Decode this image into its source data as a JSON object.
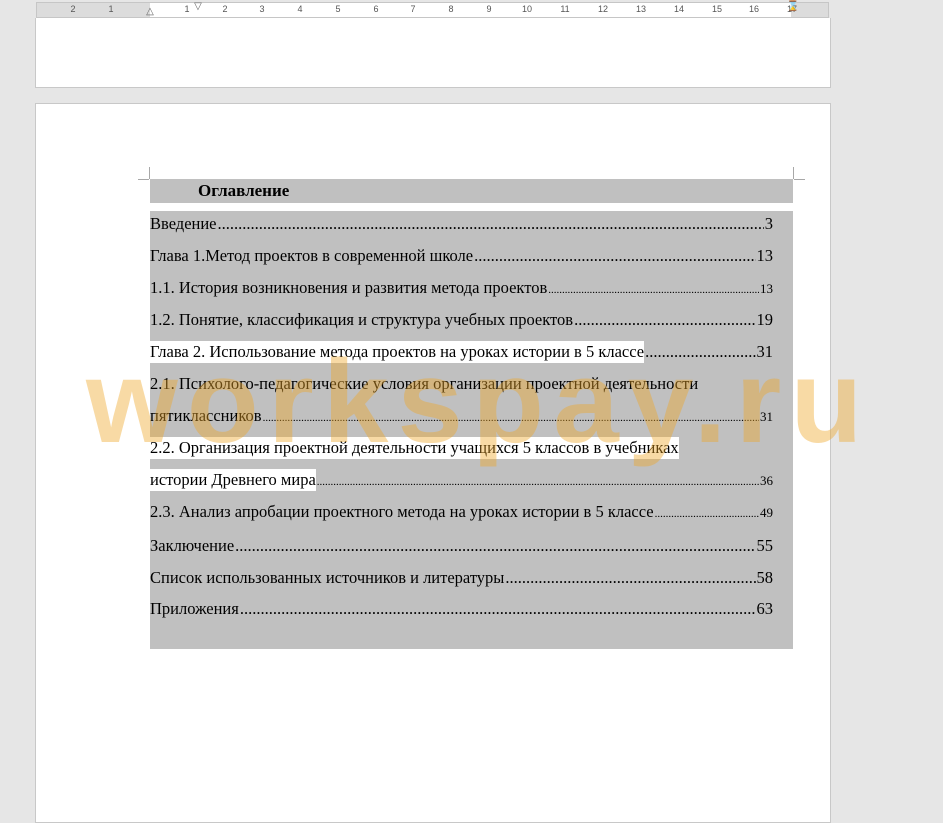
{
  "ruler": {
    "numbers": [
      "2",
      "1",
      "1",
      "2",
      "3",
      "4",
      "5",
      "6",
      "7",
      "8",
      "9",
      "10",
      "11",
      "12",
      "13",
      "14",
      "15",
      "16",
      "17"
    ]
  },
  "toc": {
    "title": "Оглавление",
    "entries": [
      {
        "text": "Введение",
        "page": "3"
      },
      {
        "text": "Глава 1.Метод проектов в современной школе",
        "page": "13"
      },
      {
        "text": "1.1. История возникновения и развития метода проектов",
        "page": "13"
      },
      {
        "text": "1.2. Понятие, классификация и структура учебных проектов",
        "page": "19"
      },
      {
        "text": "Глава 2. Использование метода проектов  на уроках истории в 5 классе",
        "page": "31"
      },
      {
        "text": "2.1. Психолого-педагогические условия организации проектной деятельности",
        "page": ""
      },
      {
        "text": "пятиклассников",
        "page": "31"
      },
      {
        "text": "2.2. Организация проектной деятельности учащихся 5 классов в учебниках",
        "page": ""
      },
      {
        "text": "истории Древнего мира",
        "page": "36"
      },
      {
        "text": "2.3. Анализ апробации проектного метода на уроках истории в 5 классе",
        "page": "49"
      },
      {
        "text": "Заключение",
        "page": "55"
      },
      {
        "text": "Список использованных источников и литературы",
        "page": "58"
      },
      {
        "text": "Приложения",
        "page": "63"
      }
    ]
  },
  "watermark": {
    "text": "workspay.ru"
  },
  "colors": {
    "field_shading": "#c0c0c0",
    "watermark": "#eea828"
  }
}
